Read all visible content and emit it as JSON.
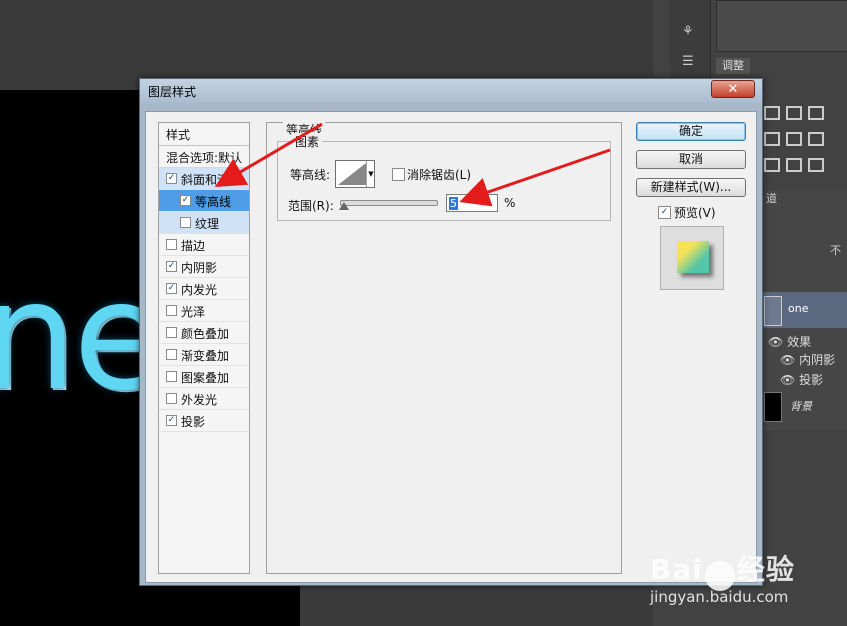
{
  "window": {
    "title": "图层样式"
  },
  "canvas_text": "ne",
  "ps": {
    "adjust_tab": "调整",
    "layers_tab_fragment": "道",
    "blend_fragment": "不",
    "layer_one_name": "one",
    "fx_label": "效果",
    "fx_items": [
      "内阴影",
      "投影"
    ],
    "bg_layer_name": "背景"
  },
  "styles": {
    "header": "样式",
    "blend_options": "混合选项:默认",
    "items": [
      {
        "label": "斜面和浮雕",
        "checked": true
      },
      {
        "label": "等高线",
        "checked": true
      },
      {
        "label": "纹理",
        "checked": false
      },
      {
        "label": "描边",
        "checked": false
      },
      {
        "label": "内阴影",
        "checked": true
      },
      {
        "label": "内发光",
        "checked": true
      },
      {
        "label": "光泽",
        "checked": false
      },
      {
        "label": "颜色叠加",
        "checked": false
      },
      {
        "label": "渐变叠加",
        "checked": false
      },
      {
        "label": "图案叠加",
        "checked": false
      },
      {
        "label": "外发光",
        "checked": false
      },
      {
        "label": "投影",
        "checked": true
      }
    ]
  },
  "contour_panel": {
    "group_title": "等高线",
    "sub_group_title": "图素",
    "contour_label": "等高线:",
    "anti_alias_label": "消除锯齿(L)",
    "range_label": "范围(R):",
    "range_value": "5",
    "range_unit": "%"
  },
  "buttons": {
    "ok": "确定",
    "cancel": "取消",
    "new_style": "新建样式(W)...",
    "preview": "预览(V)"
  },
  "watermark": {
    "brand_a": "Bai",
    "brand_b": "经验",
    "url": "jingyan.baidu.com"
  },
  "colors": {
    "selected": "#4f9de6",
    "arrow": "#e31b1b",
    "canvas_text": "#5fd7f3"
  }
}
